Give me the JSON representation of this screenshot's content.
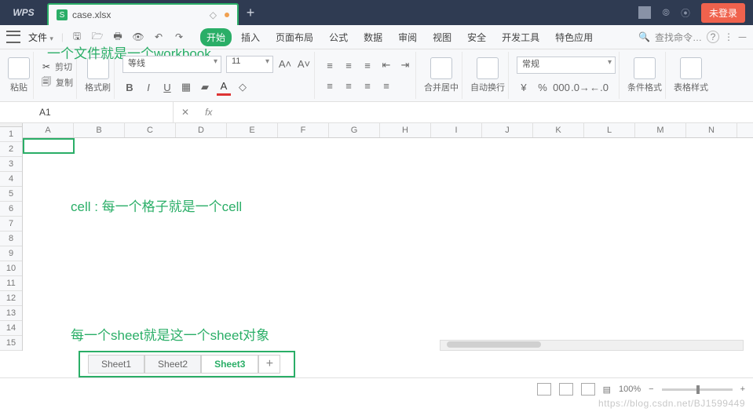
{
  "title_bar": {
    "app": "WPS",
    "file_tab": "case.xlsx",
    "login": "未登录"
  },
  "quickbar": {
    "file_menu": "文件"
  },
  "menu_tabs": [
    "开始",
    "插入",
    "页面布局",
    "公式",
    "数据",
    "审阅",
    "视图",
    "安全",
    "开发工具",
    "特色应用"
  ],
  "active_tab": "开始",
  "search_placeholder": "查找命令…",
  "ribbon": {
    "paste": "粘贴",
    "cut": "剪切",
    "copy": "复制",
    "format_painter": "格式刷",
    "font_name": "等线",
    "font_size": "11",
    "merge": "合并居中",
    "wrap": "自动换行",
    "number_format": "常规",
    "cond_format": "条件格式",
    "table_style": "表格样式"
  },
  "namebox": "A1",
  "columns": [
    "A",
    "B",
    "C",
    "D",
    "E",
    "F",
    "G",
    "H",
    "I",
    "J",
    "K",
    "L",
    "M",
    "N"
  ],
  "rows": [
    "1",
    "2",
    "3",
    "4",
    "5",
    "6",
    "7",
    "8",
    "9",
    "10",
    "11",
    "12",
    "13",
    "14",
    "15"
  ],
  "sheet_tabs": [
    "Sheet1",
    "Sheet2",
    "Sheet3"
  ],
  "active_sheet": "Sheet3",
  "zoom": "100%",
  "annotations": {
    "workbook": "一个文件就是一个workbook",
    "cell": "cell :  每一个格子就是一个cell",
    "sheet": "每一个sheet就是这一个sheet对象"
  },
  "watermark": "https://blog.csdn.net/BJ1599449"
}
